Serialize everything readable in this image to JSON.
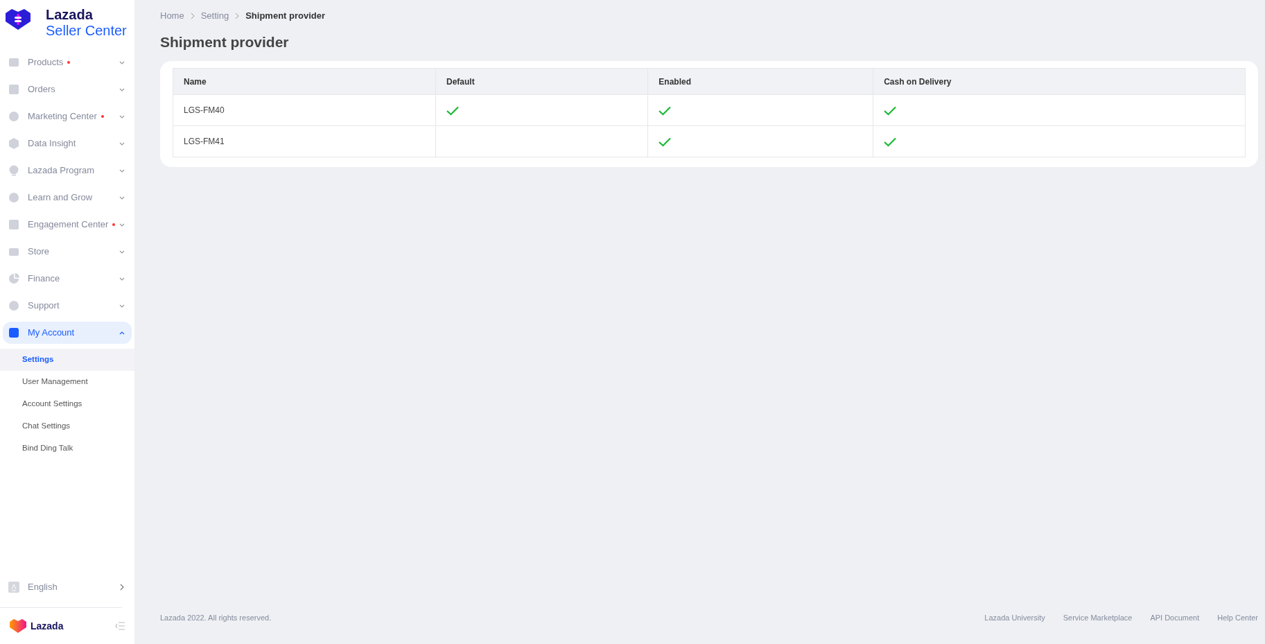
{
  "logo": {
    "line1": "Lazada",
    "line2": "Seller Center"
  },
  "menu": [
    {
      "label": "Products",
      "dot": true,
      "expanded": false,
      "selected": false
    },
    {
      "label": "Orders",
      "dot": false,
      "expanded": false,
      "selected": false
    },
    {
      "label": "Marketing Center",
      "dot": true,
      "expanded": false,
      "selected": false
    },
    {
      "label": "Data Insight",
      "dot": false,
      "expanded": false,
      "selected": false
    },
    {
      "label": "Lazada Program",
      "dot": false,
      "expanded": false,
      "selected": false
    },
    {
      "label": "Learn and Grow",
      "dot": false,
      "expanded": false,
      "selected": false
    },
    {
      "label": "Engagement Center",
      "dot": true,
      "expanded": false,
      "selected": false
    },
    {
      "label": "Store",
      "dot": false,
      "expanded": false,
      "selected": false
    },
    {
      "label": "Finance",
      "dot": false,
      "expanded": false,
      "selected": false
    },
    {
      "label": "Support",
      "dot": false,
      "expanded": false,
      "selected": false
    },
    {
      "label": "My Account",
      "dot": false,
      "expanded": true,
      "selected": true,
      "children": [
        {
          "label": "Settings",
          "selected": true
        },
        {
          "label": "User Management",
          "selected": false
        },
        {
          "label": "Account Settings",
          "selected": false
        },
        {
          "label": "Chat Settings",
          "selected": false
        },
        {
          "label": "Bind Ding Talk",
          "selected": false
        }
      ]
    }
  ],
  "language": {
    "label": "English"
  },
  "footer_logo": {
    "label": "Lazada"
  },
  "breadcrumb": [
    {
      "label": "Home",
      "current": false
    },
    {
      "label": "Setting",
      "current": false
    },
    {
      "label": "Shipment provider",
      "current": true
    }
  ],
  "title": "Shipment provider",
  "table": {
    "columns": [
      "Name",
      "Default",
      "Enabled",
      "Cash on Delivery"
    ],
    "rows": [
      {
        "name": "LGS-FM40",
        "checks": [
          true,
          true,
          true
        ]
      },
      {
        "name": "LGS-FM41",
        "checks": [
          false,
          true,
          true
        ]
      }
    ]
  },
  "footer": {
    "copyright": "Lazada 2022. All rights reserved.",
    "links": [
      "Lazada University",
      "Service Marketplace",
      "API Document",
      "Help Center"
    ]
  }
}
